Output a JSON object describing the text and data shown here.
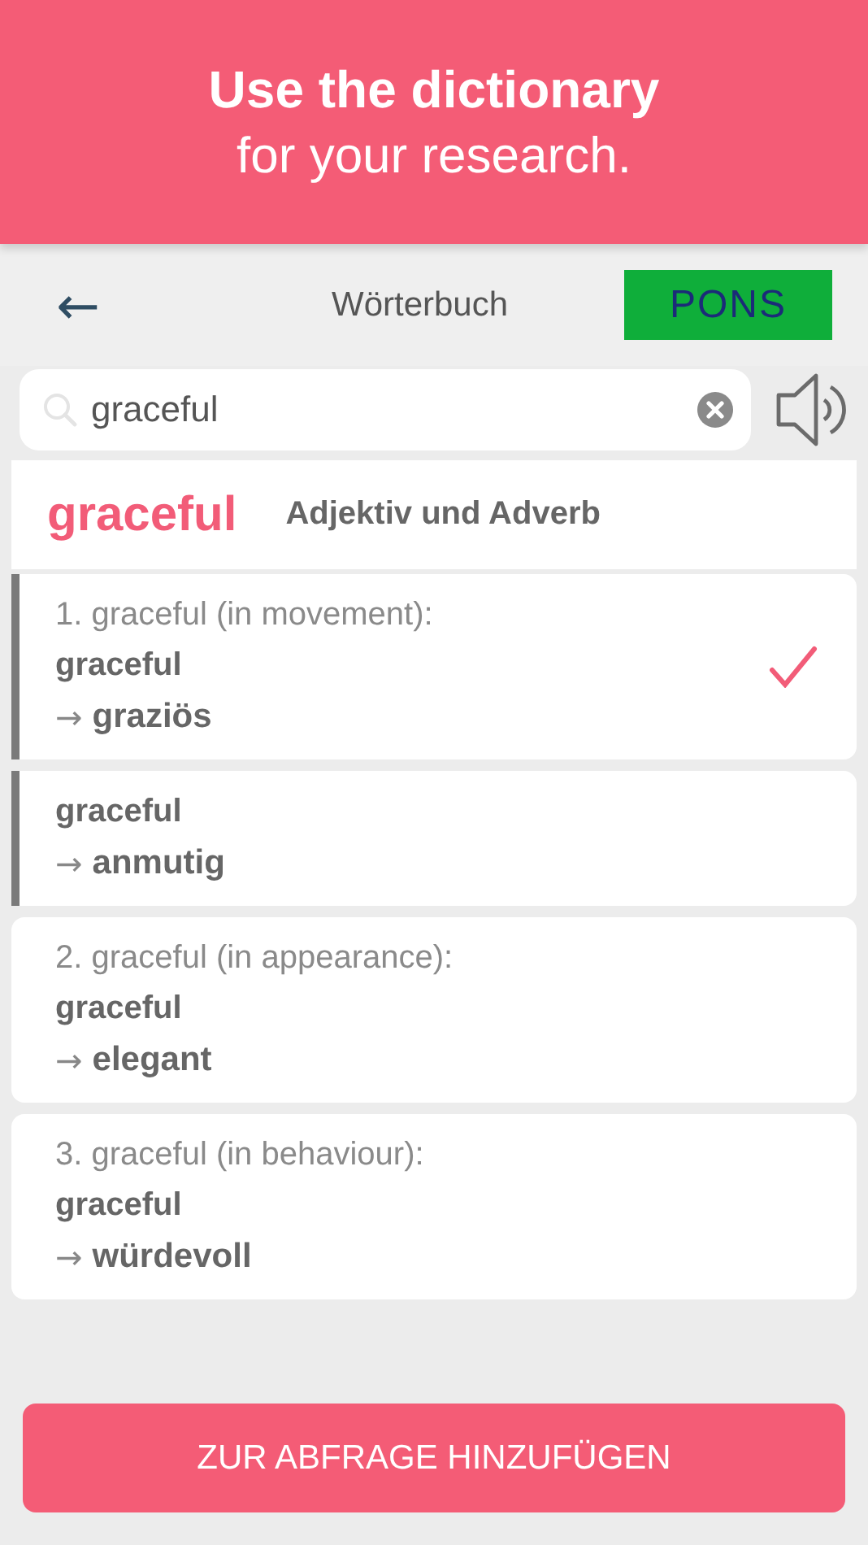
{
  "banner": {
    "title": "Use the dictionary",
    "subtitle": "for your research."
  },
  "nav": {
    "back": "←",
    "title": "Wörterbuch",
    "brand": "PONS"
  },
  "search": {
    "value": "graceful"
  },
  "headword": {
    "word": "graceful",
    "part_of_speech": "Adjektiv und Adverb"
  },
  "entries": [
    {
      "heading": "1. graceful (in movement):",
      "source": "graceful",
      "arrow": "→",
      "target": "graziös",
      "selected": true,
      "highlighted": true
    },
    {
      "source": "graceful",
      "arrow": "→",
      "target": "anmutig",
      "selected": false,
      "highlighted": true
    },
    {
      "heading": "2. graceful (in appearance):",
      "source": "graceful",
      "arrow": "→",
      "target": "elegant",
      "selected": false,
      "highlighted": false
    },
    {
      "heading": "3. graceful (in behaviour):",
      "source": "graceful",
      "arrow": "→",
      "target": "würdevoll",
      "selected": false,
      "highlighted": false
    }
  ],
  "button": "ZUR ABFRAGE HINZUFÜGEN"
}
